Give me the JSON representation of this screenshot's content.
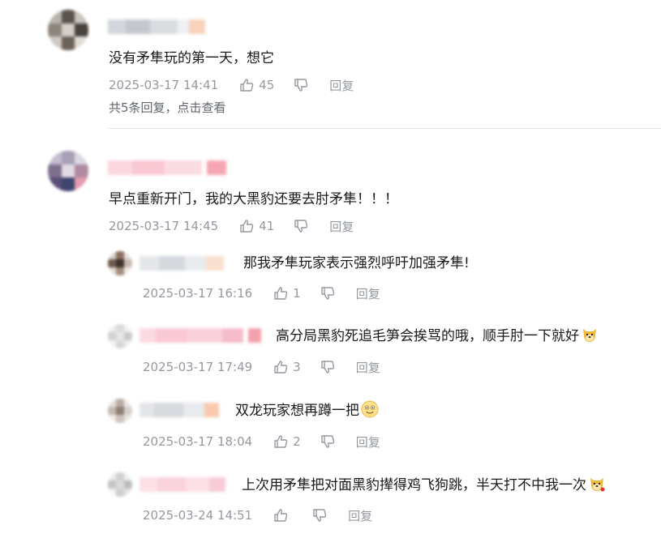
{
  "comments": [
    {
      "content": "没有矛隼玩的第一天，想它",
      "time": "2025-03-17 14:41",
      "likes": "45",
      "reply_label": "回复",
      "more_replies": "共5条回复，点击查看"
    },
    {
      "content": "早点重新开门，我的大黑豹还要去肘矛隼！！！",
      "time": "2025-03-17 14:45",
      "likes": "41",
      "reply_label": "回复",
      "replies": [
        {
          "content": "那我矛隼玩家表示强烈呼吁加强矛隼!",
          "time": "2025-03-17 16:16",
          "likes": "1",
          "reply_label": "回复"
        },
        {
          "content": "高分局黑豹死追毛笋会挨骂的哦，顺手肘一下就好",
          "emoji": "doge-icon",
          "time": "2025-03-17 17:49",
          "likes": "3",
          "reply_label": "回复"
        },
        {
          "content": "双龙玩家想再蹲一把",
          "emoji": "smile-emoji-icon",
          "time": "2025-03-17 18:04",
          "likes": "2",
          "reply_label": "回复"
        },
        {
          "content": "上次用矛隼把对面黑豹撵得鸡飞狗跳，半天打不中我一次",
          "emoji": "doge-icon",
          "time": "2025-03-24 14:51",
          "likes": "",
          "reply_label": "回复"
        }
      ]
    }
  ],
  "colors": {
    "text": "#18191c",
    "meta": "#9499a0",
    "link": "#61666d",
    "divider": "#e3e5e7"
  }
}
